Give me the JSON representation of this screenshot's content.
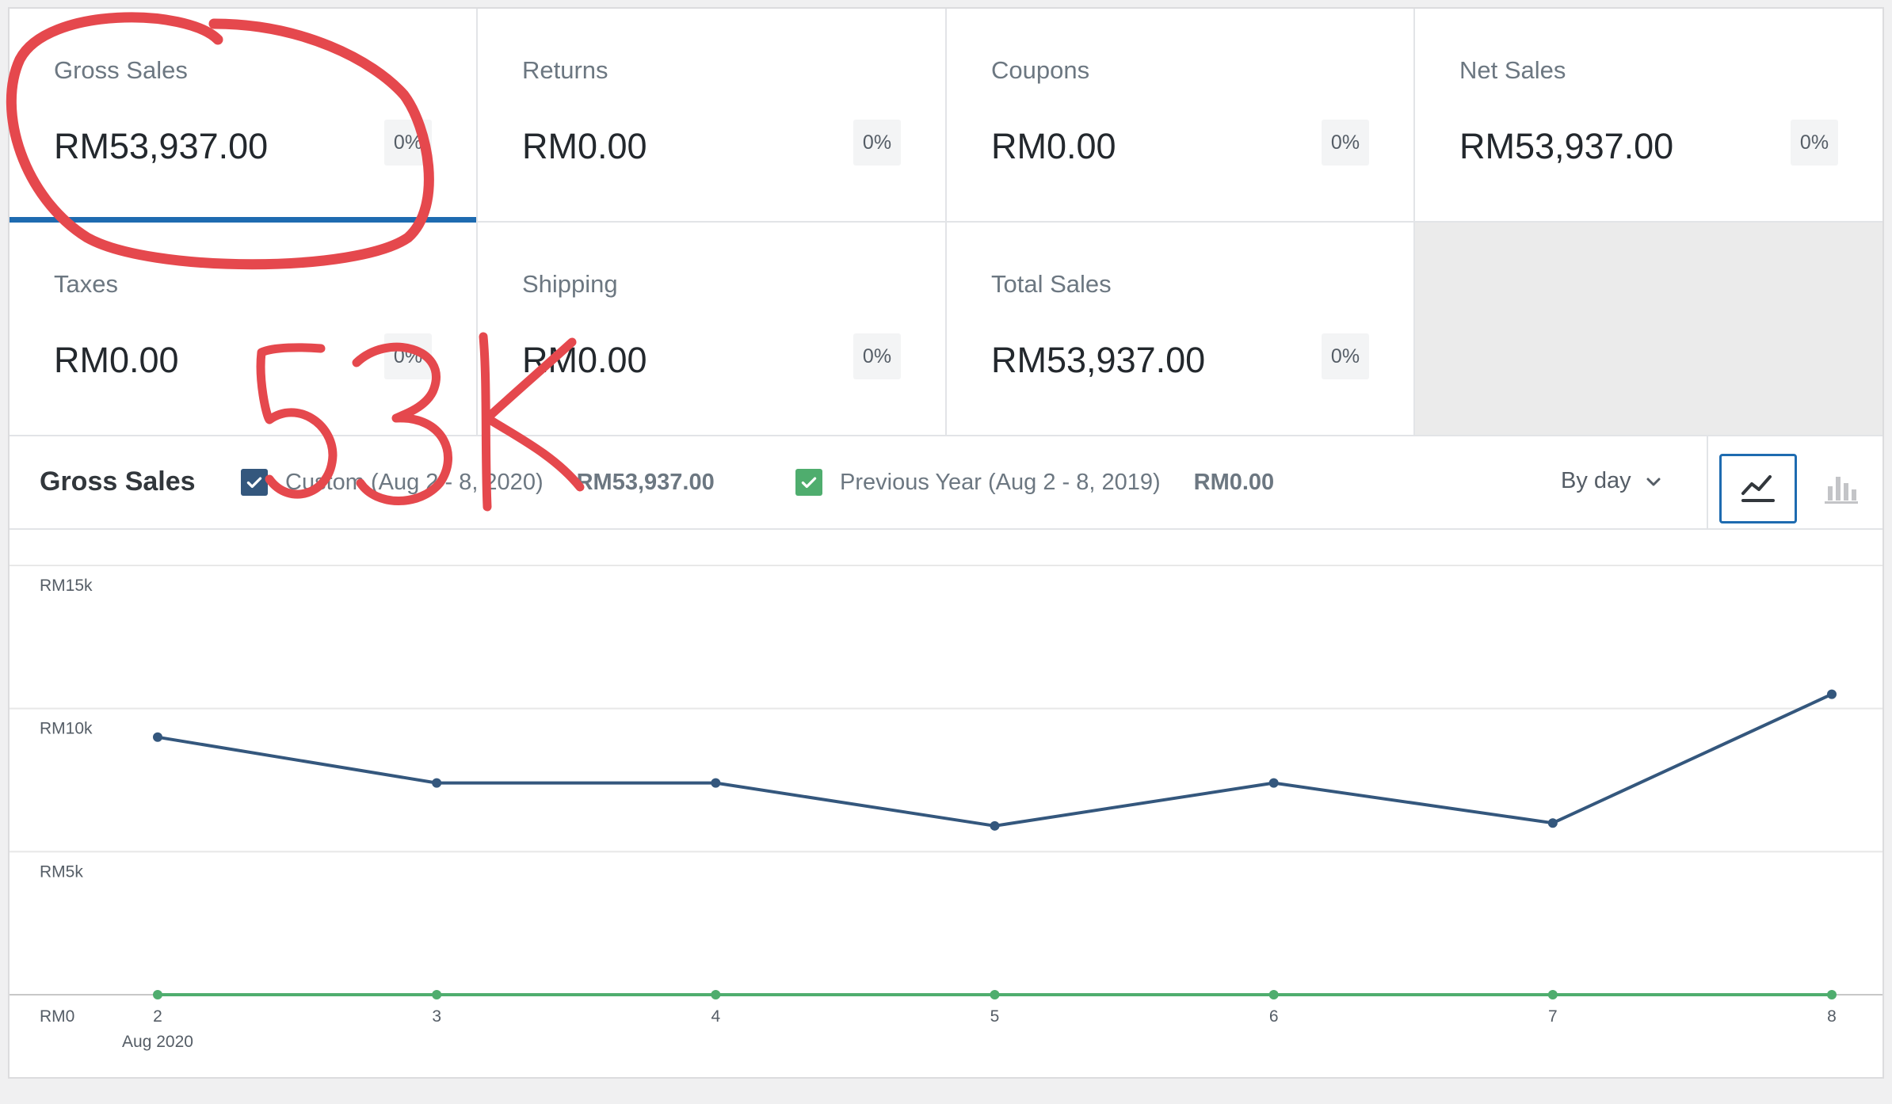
{
  "tiles": [
    {
      "label": "Gross Sales",
      "value": "RM53,937.00",
      "delta": "0%",
      "selected": true
    },
    {
      "label": "Returns",
      "value": "RM0.00",
      "delta": "0%"
    },
    {
      "label": "Coupons",
      "value": "RM0.00",
      "delta": "0%"
    },
    {
      "label": "Net Sales",
      "value": "RM53,937.00",
      "delta": "0%"
    },
    {
      "label": "Taxes",
      "value": "RM0.00",
      "delta": "0%"
    },
    {
      "label": "Shipping",
      "value": "RM0.00",
      "delta": "0%"
    },
    {
      "label": "Total Sales",
      "value": "RM53,937.00",
      "delta": "0%"
    }
  ],
  "chart_header": {
    "title": "Gross Sales",
    "current": {
      "label": "Custom (Aug 2 - 8, 2020)",
      "total": "RM53,937.00",
      "color": "#34577d"
    },
    "previous": {
      "label": "Previous Year (Aug 2 - 8, 2019)",
      "total": "RM0.00",
      "color": "#4fad6e"
    },
    "interval": "By day"
  },
  "annotation": {
    "text": "53K",
    "color": "#e5484d"
  },
  "chart_data": {
    "type": "line",
    "x": [
      "2",
      "3",
      "4",
      "5",
      "6",
      "7",
      "8"
    ],
    "x_sublabel": "Aug 2020",
    "yticks": [
      {
        "v": 0,
        "label": "RM0"
      },
      {
        "v": 5000,
        "label": "RM5k"
      },
      {
        "v": 10000,
        "label": "RM10k"
      },
      {
        "v": 15000,
        "label": "RM15k"
      }
    ],
    "ylim": [
      0,
      15000
    ],
    "grid": true,
    "series": [
      {
        "name": "Custom (Aug 2 - 8, 2020)",
        "color": "#34577d",
        "values": [
          9000,
          7400,
          7400,
          5900,
          7400,
          6000,
          10500
        ]
      },
      {
        "name": "Previous Year (Aug 2 - 8, 2019)",
        "color": "#4fad6e",
        "values": [
          0,
          0,
          0,
          0,
          0,
          0,
          0
        ]
      }
    ]
  }
}
